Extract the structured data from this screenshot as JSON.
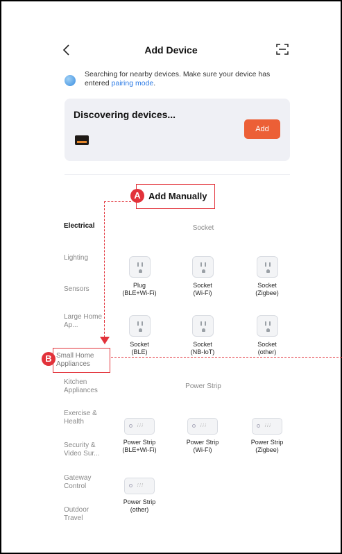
{
  "header": {
    "title": "Add Device",
    "back_icon": "chevron-left-icon",
    "scan_icon": "scan-icon"
  },
  "search_notice": {
    "text": "Searching for nearby devices. Make sure your device has entered",
    "link": "pairing mode",
    "suffix": "."
  },
  "discovering": {
    "title": "Discovering devices...",
    "add_label": "Add",
    "accent": "#ec5f36"
  },
  "annotations": {
    "a": {
      "badge": "A",
      "label": "Add Manually"
    },
    "b": {
      "badge": "B"
    },
    "color": "#e2323a"
  },
  "sidebar": {
    "items": [
      {
        "label": "Electrical"
      },
      {
        "label": "Lighting"
      },
      {
        "label": "Sensors"
      },
      {
        "label": "Large Home Ap..."
      },
      {
        "label": "Small Home Appliances"
      },
      {
        "label": "Kitchen Appliances"
      },
      {
        "label": "Exercise & Health"
      },
      {
        "label": "Security & Video Sur..."
      },
      {
        "label": "Gateway Control"
      },
      {
        "label": "Outdoor Travel"
      }
    ]
  },
  "sections": [
    {
      "title": "Socket",
      "devices": [
        {
          "name": "Plug",
          "sub": "(BLE+Wi-Fi)"
        },
        {
          "name": "Socket",
          "sub": "(Wi-Fi)"
        },
        {
          "name": "Socket",
          "sub": "(Zigbee)"
        },
        {
          "name": "Socket",
          "sub": "(BLE)"
        },
        {
          "name": "Socket",
          "sub": "(NB-IoT)"
        },
        {
          "name": "Socket",
          "sub": "(other)"
        }
      ]
    },
    {
      "title": "Power Strip",
      "devices": [
        {
          "name": "Power Strip",
          "sub": "(BLE+Wi-Fi)"
        },
        {
          "name": "Power Strip",
          "sub": "(Wi-Fi)"
        },
        {
          "name": "Power Strip",
          "sub": "(Zigbee)"
        },
        {
          "name": "Power Strip",
          "sub": "(other)"
        }
      ]
    }
  ]
}
